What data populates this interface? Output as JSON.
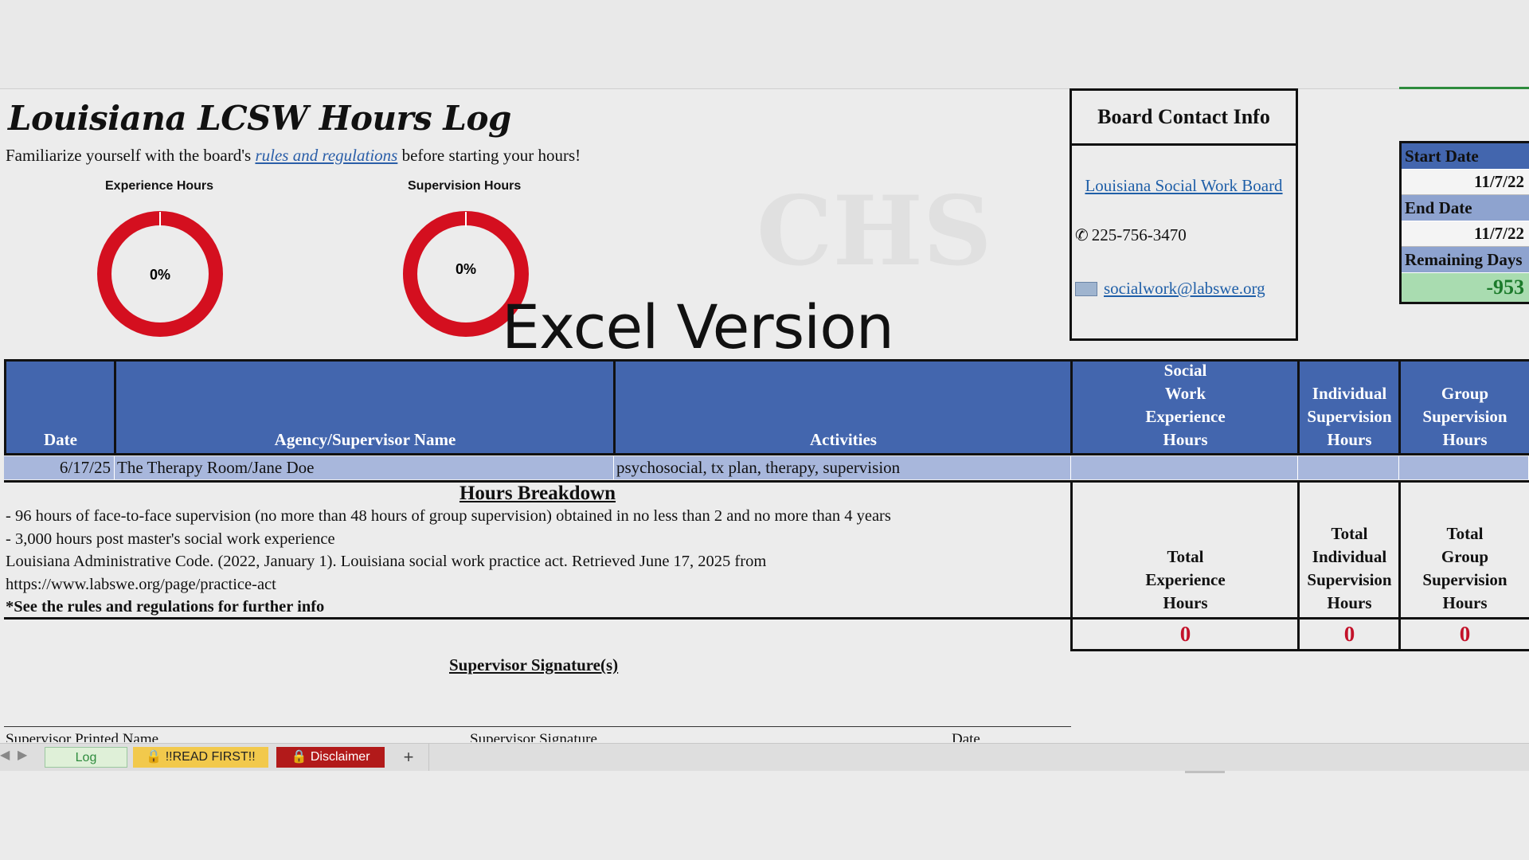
{
  "title": "Louisiana LCSW Hours Log",
  "intro": {
    "before": "Familiarize yourself with the board's ",
    "link": "rules and regulations",
    "after": " before starting your hours!"
  },
  "gauges": [
    {
      "label": "Experience Hours",
      "percent_text": "0%",
      "progress": 0
    },
    {
      "label": "Supervision Hours",
      "percent_text": "0%",
      "progress": 0
    }
  ],
  "watermark": "Excel Version",
  "board": {
    "header": "Board Contact Info",
    "link": "Louisiana Social Work Board",
    "phone": "225-756-3470",
    "email": "socialwork@labswe.org"
  },
  "dates": {
    "start_label": "Start Date",
    "start_value": "11/7/22",
    "end_label": "End Date",
    "end_value": "11/7/22",
    "remaining_label": "Remaining Days",
    "remaining_value": "-953"
  },
  "table": {
    "headers": {
      "date": "Date",
      "agency": "Agency/Supervisor Name",
      "activities": "Activities",
      "sw_exp": [
        "Social",
        "Work",
        "Experience",
        "Hours"
      ],
      "ind_sup": [
        "Individual",
        "Supervision",
        "Hours"
      ],
      "grp_sup": [
        "Group",
        "Supervision",
        "Hours"
      ]
    },
    "rows": [
      {
        "date": "6/17/25",
        "agency": "The Therapy Room/Jane Doe",
        "activities": "psychosocial, tx plan, therapy, supervision"
      }
    ]
  },
  "breakdown": {
    "heading": "Hours Breakdown",
    "lines": [
      "- 96 hours of face-to-face supervision (no more than 48 hours of group supervision) obtained in no less than 2 and no more than 4 years",
      "- 3,000 hours post master's social work experience",
      "Louisiana Administrative Code. (2022, January 1). Louisiana social work practice act. Retrieved June 17, 2025 from",
      "https://www.labswe.org/page/practice-act"
    ],
    "note": "*See the rules and regulations for further info"
  },
  "totals": {
    "exp_label": [
      "Total",
      "Experience",
      "Hours"
    ],
    "ind_label": [
      "Total",
      "Individual",
      "Supervision",
      "Hours"
    ],
    "grp_label": [
      "Total",
      "Group",
      "Supervision",
      "Hours"
    ],
    "exp_value": "0",
    "ind_value": "0",
    "grp_value": "0"
  },
  "signature": {
    "heading": "Supervisor Signature(s)",
    "printed_name": "Supervisor Printed Name",
    "signature": "Supervisor Signature",
    "date": "Date"
  },
  "tabs": {
    "log": "Log",
    "read_first": "!!READ FIRST!!",
    "disclaimer": "Disclaimer",
    "add": "+"
  },
  "colors": {
    "header_blue": "#4366ae",
    "gauge_red": "#d40f1f",
    "total_red": "#c3122a",
    "remaining_green": "#a9dcb0"
  }
}
